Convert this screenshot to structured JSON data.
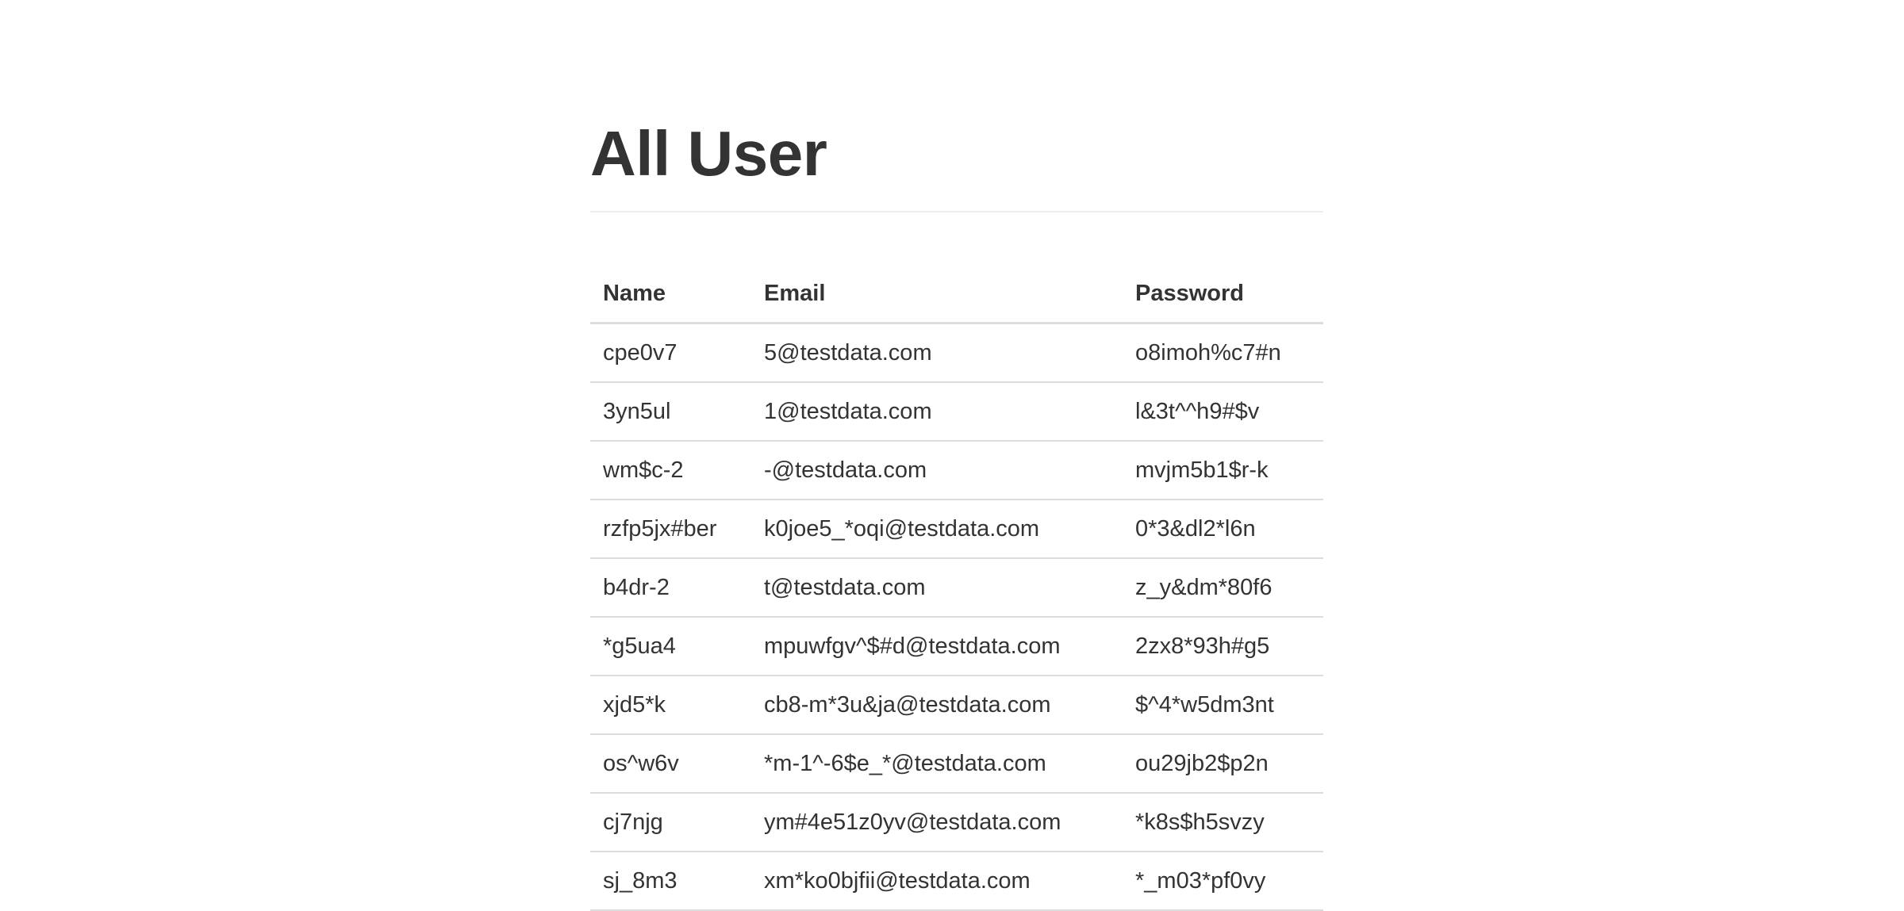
{
  "page": {
    "title": "All User"
  },
  "table": {
    "headers": {
      "name": "Name",
      "email": "Email",
      "password": "Password"
    },
    "rows": [
      {
        "name": "cpe0v7",
        "email": "5@testdata.com",
        "password": "o8imoh%c7#n"
      },
      {
        "name": "3yn5ul",
        "email": "1@testdata.com",
        "password": "l&3t^^h9#$v"
      },
      {
        "name": "wm$c-2",
        "email": "-@testdata.com",
        "password": "mvjm5b1$r-k"
      },
      {
        "name": "rzfp5jx#ber",
        "email": "k0joe5_*oqi@testdata.com",
        "password": "0*3&dl2*l6n"
      },
      {
        "name": "b4dr-2",
        "email": "t@testdata.com",
        "password": "z_y&dm*80f6"
      },
      {
        "name": "*g5ua4",
        "email": "mpuwfgv^$#d@testdata.com",
        "password": "2zx8*93h#g5"
      },
      {
        "name": "xjd5*k",
        "email": "cb8-m*3u&ja@testdata.com",
        "password": "$^4*w5dm3nt"
      },
      {
        "name": "os^w6v",
        "email": "*m-1^-6$e_*@testdata.com",
        "password": "ou29jb2$p2n"
      },
      {
        "name": "cj7njg",
        "email": "ym#4e51z0yv@testdata.com",
        "password": "*k8s$h5svzy"
      },
      {
        "name": "sj_8m3",
        "email": "xm*ko0bjfii@testdata.com",
        "password": "*_m03*pf0vy"
      }
    ]
  }
}
